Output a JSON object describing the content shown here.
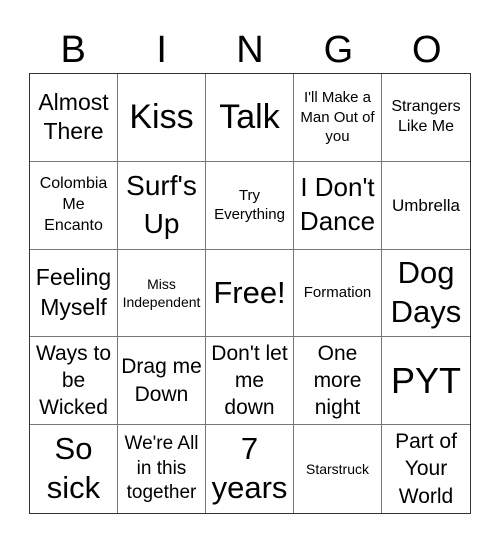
{
  "header": {
    "letters": [
      "B",
      "I",
      "N",
      "G",
      "O"
    ]
  },
  "cells": [
    "Almost There",
    "Kiss",
    "Talk",
    "I'll Make a Man Out of you",
    "Strangers Like Me",
    "Colombia Me Encanto",
    "Surf's Up",
    "Try Everything",
    "I Don't Dance",
    "Umbrella",
    "Feeling Myself",
    "Miss Independent",
    "Free!",
    "Formation",
    "Dog Days",
    "Ways to be Wicked",
    "Drag me Down",
    "Don't let me down",
    "One more night",
    "PYT",
    "So sick",
    "We're All in this together",
    "7 years",
    "Starstruck",
    "Part of Your World"
  ]
}
